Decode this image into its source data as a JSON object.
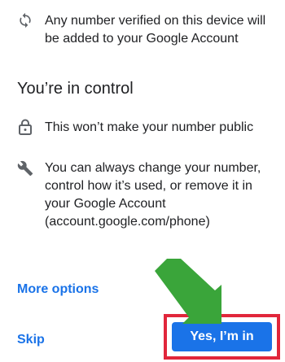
{
  "sync_item": {
    "icon": "sync-icon",
    "text": "Any number verified on this device will be added to your Google Account"
  },
  "control_section": {
    "title": "You’re in control"
  },
  "lock_item": {
    "icon": "lock-icon",
    "text": "This won’t make your number public"
  },
  "wrench_item": {
    "icon": "wrench-icon",
    "text": "You can always change your number, control how it’s used, or remove it in your Google Account (account.google.com/phone)"
  },
  "actions": {
    "more_options": "More options",
    "skip": "Skip",
    "confirm": "Yes, I’m in"
  },
  "colors": {
    "link": "#1a73e8",
    "primary_button": "#1a73e8",
    "highlight_border": "#e1263b",
    "annotation_arrow": "#3aa53a"
  }
}
